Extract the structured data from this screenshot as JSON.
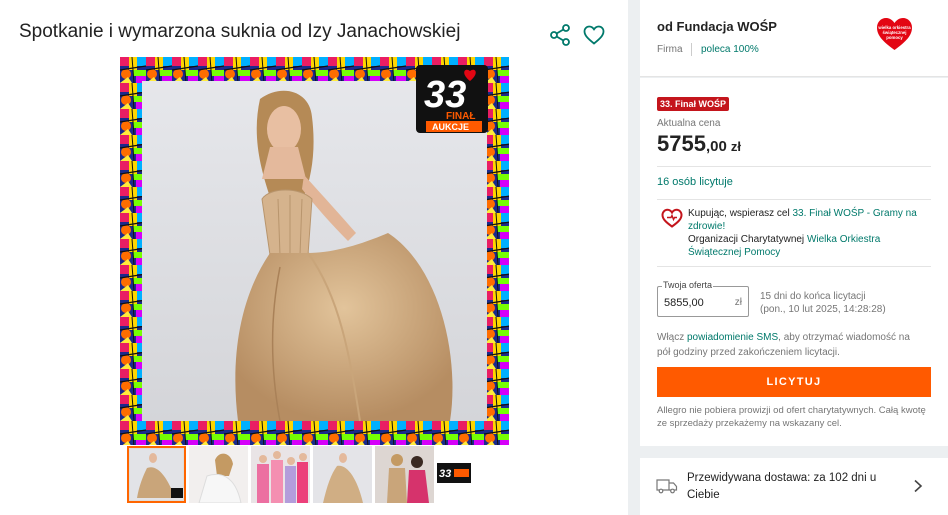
{
  "listing": {
    "title": "Spotkanie i wymarzona suknia od Izy Janachowskiej",
    "image_badge": {
      "number": "33",
      "line1": "FINAŁ",
      "line2": "AUKCJE"
    }
  },
  "icons": {
    "share": "share-icon",
    "favorite": "heart-outline-icon",
    "delivery": "truck-icon",
    "chevron": "chevron-right-icon"
  },
  "thumbnails": [
    {
      "name": "dress-photo-1",
      "active": true
    },
    {
      "name": "dress-photo-2",
      "active": false
    },
    {
      "name": "group-photo-3",
      "active": false
    },
    {
      "name": "dress-photo-4",
      "active": false
    },
    {
      "name": "fitting-photo-5",
      "active": false
    },
    {
      "name": "wosp-banner-6",
      "active": false
    }
  ],
  "seller": {
    "prefix": "od",
    "name": "Fundacja WOŚP",
    "type": "Firma",
    "recommendation": "poleca 100%",
    "logo_text": "wielka orkiestra świątecznej pomocy"
  },
  "offer": {
    "badge": "33. Finał WOŚP",
    "price_label": "Aktualna cena",
    "price_int": "5755",
    "price_dec": ",00",
    "currency": "zł",
    "bidders": "16 osób licytuje",
    "support_prefix": "Kupując, wspierasz cel ",
    "support_goal": "33. Finał WOŚP - Gramy na zdrowie!",
    "support_org_prefix": "Organizacji Charytatywnej ",
    "support_org": "Wielka Orkiestra Świątecznej Pomocy",
    "bid_legend": "Twoja oferta",
    "bid_value": "5855,00",
    "bid_currency": "zł",
    "time_left": "15 dni do końca licytacji",
    "end_date": "(pon., 10 lut 2025, 14:28:28)",
    "sms_prefix": "Włącz ",
    "sms_link": "powiadomienie SMS",
    "sms_suffix": ", aby otrzymać wiadomość na pół godziny przed zakończeniem licytacji.",
    "bid_button": "LICYTUJ",
    "commission": "Allegro nie pobiera prowizji od ofert charytatywnych. Całą kwotę ze sprzedaży przekażemy na wskazany cel."
  },
  "delivery": {
    "text": "Przewidywana dostawa: za 102 dni u Ciebie"
  },
  "colors": {
    "accent": "#ff5a00",
    "link": "#00796b",
    "badge": "#c4151c",
    "wosp_red": "#e30613"
  }
}
